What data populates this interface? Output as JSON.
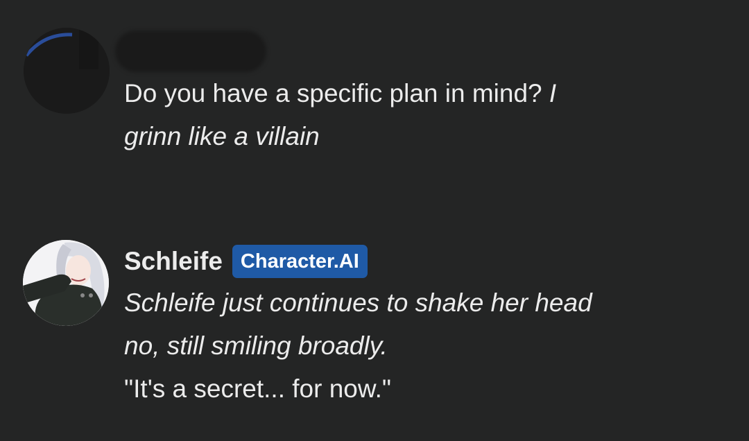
{
  "messages": [
    {
      "sender": "user",
      "text_plain": "Do you have a specific plan in mind? ",
      "text_italic_1": "I",
      "text_italic_2": "grinn like a villain"
    },
    {
      "sender": "character",
      "name": "Schleife",
      "badge": "Character.AI",
      "line1": "Schleife just continues to shake her head",
      "line2": "no, still smiling broadly.",
      "line3": "\"It's a secret... for now.\""
    }
  ],
  "colors": {
    "background": "#242525",
    "text": "#ececec",
    "badge_bg": "#1f5aa6"
  }
}
